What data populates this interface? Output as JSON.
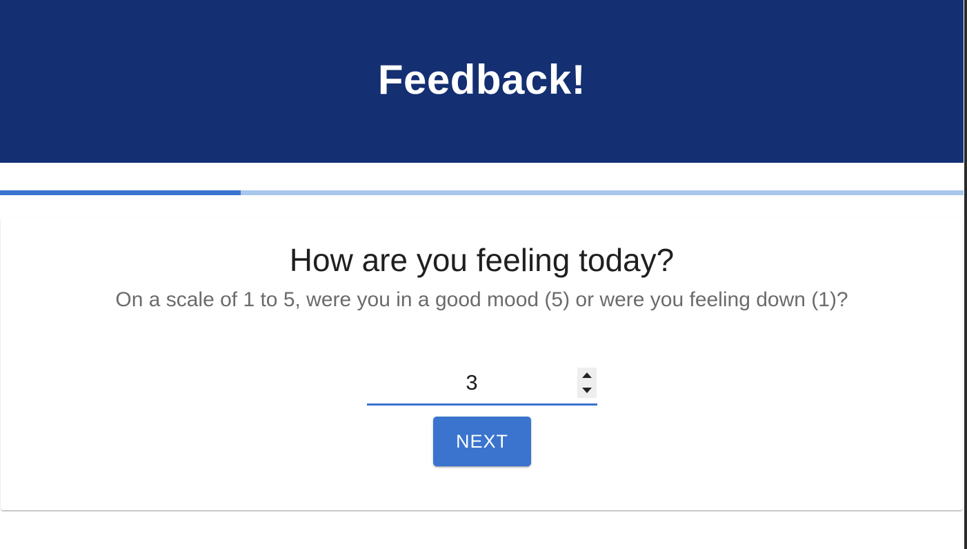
{
  "header": {
    "title": "Feedback!",
    "background_color": "#142f72"
  },
  "progress": {
    "fraction": 0.25,
    "fill_color": "#3a74cf",
    "track_color": "#a9c6ec"
  },
  "question": {
    "title": "How are you feeling today?",
    "subtitle": "On a scale of 1 to 5, were you in a good mood (5) or were you feeling down (1)?",
    "input": {
      "value": "3"
    },
    "next_label": "NEXT"
  },
  "colors": {
    "accent": "#3a74cf"
  }
}
